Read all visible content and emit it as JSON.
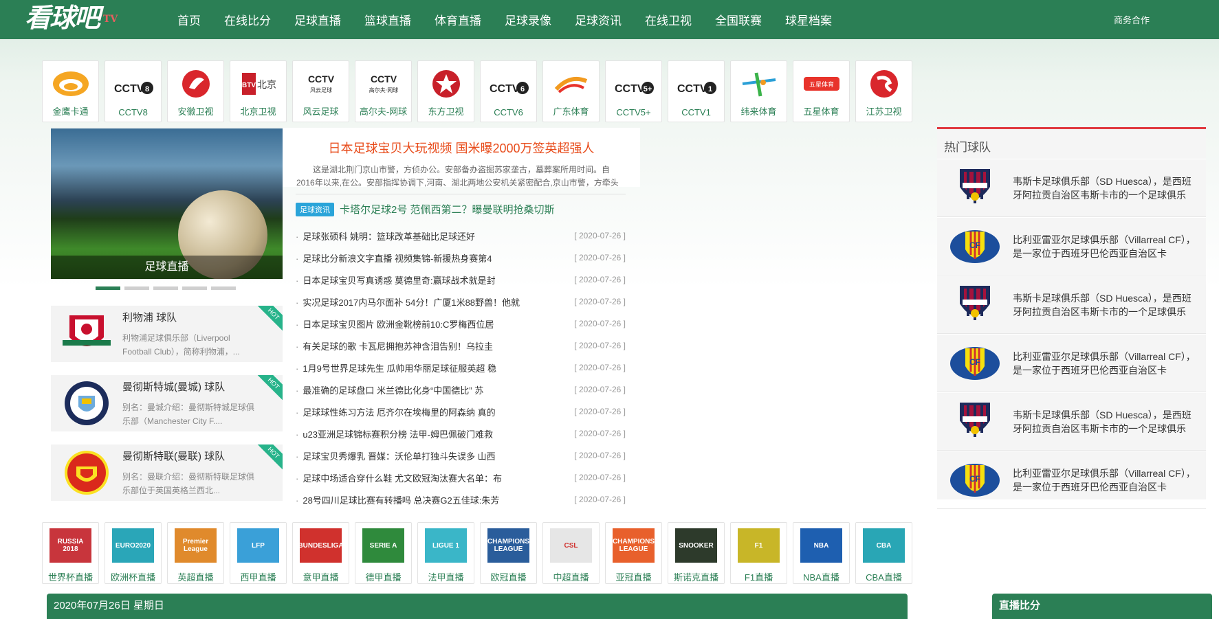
{
  "header": {
    "logo": "看球吧",
    "logo_tv": "TV",
    "nav": [
      "首页",
      "在线比分",
      "足球直播",
      "篮球直播",
      "体育直播",
      "足球录像",
      "足球资讯",
      "在线卫视",
      "全国联赛",
      "球星档案"
    ],
    "business": "商务合作"
  },
  "channels": [
    {
      "label": "金鹰卡通",
      "icon": "golden-eagle-icon"
    },
    {
      "label": "CCTV8",
      "icon": "cctv8-icon"
    },
    {
      "label": "安徽卫视",
      "icon": "anhui-tv-icon"
    },
    {
      "label": "北京卫视",
      "icon": "btv-icon"
    },
    {
      "label": "风云足球",
      "icon": "fengyun-football-icon"
    },
    {
      "label": "高尔夫-网球",
      "icon": "golf-tennis-icon"
    },
    {
      "label": "东方卫视",
      "icon": "dragon-tv-icon"
    },
    {
      "label": "CCTV6",
      "icon": "cctv6-icon"
    },
    {
      "label": "广东体育",
      "icon": "guangdong-sports-icon"
    },
    {
      "label": "CCTV5+",
      "icon": "cctv5plus-icon"
    },
    {
      "label": "CCTV1",
      "icon": "cctv1-icon"
    },
    {
      "label": "纬来体育",
      "icon": "videoland-sports-icon"
    },
    {
      "label": "五星体育",
      "icon": "five-star-sports-icon"
    },
    {
      "label": "江苏卫视",
      "icon": "jiangsu-tv-icon"
    }
  ],
  "slider": {
    "caption": "足球直播",
    "dots": 5,
    "active_dot": 0
  },
  "headline": {
    "title": "日本足球宝贝大玩视频 国米曝2000万签英超强人",
    "summary": "这是湖北荆门京山市警，方侦办公。安部备办盗掘苏家垄古，墓葬案所用时间。自2016年以来,在公。安部指挥协调下,河南、湖北两地公安机关紧密配合,京山市警，方牵头",
    "tag": "足球资讯",
    "featured": "卡塔尔足球2号 范佩西第二？曝曼联明抢桑切斯"
  },
  "news": [
    {
      "title": "足球张硕科 姚明：篮球改革基础比足球还好",
      "date": "[ 2020-07-26 ]"
    },
    {
      "title": "足球比分新浪文字直播 视频集锦-新援热身赛第4",
      "date": "[ 2020-07-26 ]"
    },
    {
      "title": "日本足球宝贝写真诱惑 莫德里奇:赢球战术就是封",
      "date": "[ 2020-07-26 ]"
    },
    {
      "title": "实况足球2017内马尔面补 54分！广厦1米88野兽！他就",
      "date": "[ 2020-07-26 ]"
    },
    {
      "title": "日本足球宝贝图片 欧洲金靴榜前10:C罗梅西位居",
      "date": "[ 2020-07-26 ]"
    },
    {
      "title": "有关足球的歌 卡瓦尼拥抱苏神含泪告别！乌拉圭",
      "date": "[ 2020-07-26 ]"
    },
    {
      "title": "1月9号世界足球先生 瓜帅用华丽足球征服英超 稳",
      "date": "[ 2020-07-26 ]"
    },
    {
      "title": "最准确的足球盘口 米兰德比化身“中国德比” 苏",
      "date": "[ 2020-07-26 ]"
    },
    {
      "title": "足球球性练习方法 厄齐尔在埃梅里的阿森纳 真的",
      "date": "[ 2020-07-26 ]"
    },
    {
      "title": "u23亚洲足球锦标赛积分榜 法甲-姆巴佩破门难救",
      "date": "[ 2020-07-26 ]"
    },
    {
      "title": "足球宝贝秀爆乳 晋媒：沃伦单打独斗失误多 山西",
      "date": "[ 2020-07-26 ]"
    },
    {
      "title": "足球中场适合穿什么鞋 尤文欧冠淘汰赛大名单：布",
      "date": "[ 2020-07-26 ]"
    },
    {
      "title": "28号四川足球比赛有转播吗 总决赛G2五佳球:朱芳",
      "date": "[ 2020-07-26 ]"
    }
  ],
  "clubs": [
    {
      "name": "利物浦 球队",
      "desc": "利物浦足球俱乐部（Liverpool Football Club），简称利物浦，...",
      "badge": "HOT",
      "icon": "liverpool-crest-icon"
    },
    {
      "name": "曼彻斯特城(曼城) 球队",
      "desc": "别名：曼城介绍：曼彻斯特城足球俱乐部（Manchester City F....",
      "badge": "HOT",
      "icon": "manchester-city-crest-icon"
    },
    {
      "name": "曼彻斯特联(曼联) 球队",
      "desc": "别名：曼联介绍：曼彻斯特联足球俱乐部位于英国英格兰西北...",
      "badge": "HOT",
      "icon": "manchester-united-crest-icon"
    }
  ],
  "hot_teams": {
    "title": "热门球队",
    "items": [
      {
        "text": "韦斯卡足球俱乐部（SD Huesca），是西班牙阿拉贡自治区韦斯卡市的一个足球俱乐",
        "icon": "sd-huesca-crest-icon"
      },
      {
        "text": "比利亚雷亚尔足球俱乐部（Villarreal CF），是一家位于西班牙巴伦西亚自治区卡",
        "icon": "villarreal-crest-icon"
      },
      {
        "text": "韦斯卡足球俱乐部（SD Huesca），是西班牙阿拉贡自治区韦斯卡市的一个足球俱乐",
        "icon": "sd-huesca-crest-icon"
      },
      {
        "text": "比利亚雷亚尔足球俱乐部（Villarreal CF），是一家位于西班牙巴伦西亚自治区卡",
        "icon": "villarreal-crest-icon"
      },
      {
        "text": "韦斯卡足球俱乐部（SD Huesca），是西班牙阿拉贡自治区韦斯卡市的一个足球俱乐",
        "icon": "sd-huesca-crest-icon"
      },
      {
        "text": "比利亚雷亚尔足球俱乐部（Villarreal CF），是一家位于西班牙巴伦西亚自治区卡",
        "icon": "villarreal-crest-icon"
      }
    ]
  },
  "leagues": [
    {
      "label": "世界杯直播",
      "icon": "world-cup-icon",
      "mark": "RUSSIA 2018",
      "color": "#c8353c"
    },
    {
      "label": "欧洲杯直播",
      "icon": "euro-icon",
      "mark": "EURO2020",
      "color": "#2aa6b8"
    },
    {
      "label": "英超直播",
      "icon": "premier-league-icon",
      "mark": "Premier League",
      "color": "#e08a2c"
    },
    {
      "label": "西甲直播",
      "icon": "laliga-icon",
      "mark": "LFP",
      "color": "#3aa0d8"
    },
    {
      "label": "意甲直播",
      "icon": "bundesliga-icon",
      "mark": "BUNDESLIGA",
      "color": "#d0312d"
    },
    {
      "label": "德甲直播",
      "icon": "serie-a-icon",
      "mark": "SERIE A",
      "color": "#2f8a3c"
    },
    {
      "label": "法甲直播",
      "icon": "ligue1-icon",
      "mark": "LIGUE 1",
      "color": "#3ab6c8"
    },
    {
      "label": "欧冠直播",
      "icon": "champions-league-icon",
      "mark": "CHAMPIONS LEAGUE",
      "color": "#2a5d9b"
    },
    {
      "label": "中超直播",
      "icon": "csl-icon",
      "mark": "CSL",
      "color": "#e6e6e6"
    },
    {
      "label": "亚冠直播",
      "icon": "afc-champions-icon",
      "mark": "CHAMPIONS LEAGUE",
      "color": "#e8602c"
    },
    {
      "label": "斯诺克直播",
      "icon": "snooker-icon",
      "mark": "SNOOKER",
      "color": "#2d3a2b"
    },
    {
      "label": "F1直播",
      "icon": "f1-icon",
      "mark": "F1",
      "color": "#c8b628"
    },
    {
      "label": "NBA直播",
      "icon": "nba-icon",
      "mark": "NBA",
      "color": "#1e5fb0"
    },
    {
      "label": "CBA直播",
      "icon": "cba-icon",
      "mark": "CBA",
      "color": "#29a6b5"
    }
  ],
  "date_bar": "2020年07月26日 星期日",
  "live_bar": "直播比分",
  "colors": {
    "brand_green": "#2b7f55",
    "headline_orange": "#e84b1a",
    "tag_blue": "#2aa4d9",
    "hot_red": "#e0393e"
  }
}
